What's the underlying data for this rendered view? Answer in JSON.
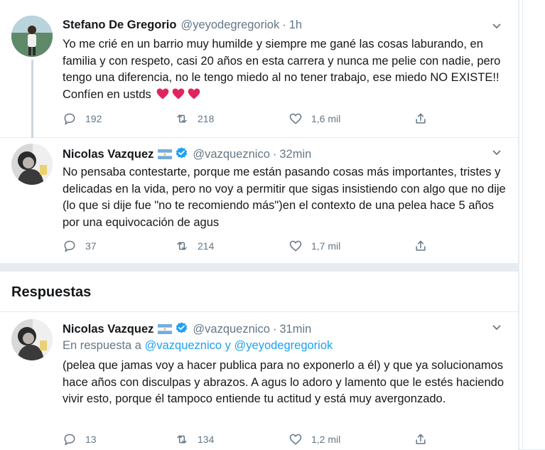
{
  "tweets": [
    {
      "name": "Stefano De Gregorio",
      "handle": "@yeyodegregoriok",
      "sep": "·",
      "time": "1h",
      "text": "Yo me crié en un barrio muy humilde y siempre me gané las cosas laburando, en familia y con respeto, casi 20 años en esta carrera y nunca me pelie con nadie, pero tengo una diferencia, no le tengo miedo al no tener trabajo, ese miedo NO EXISTE!! Confíen en ustds",
      "replies": "192",
      "retweets": "218",
      "likes": "1,6 mil"
    },
    {
      "name": "Nicolas Vazquez",
      "handle": "@vazqueznico",
      "sep": "·",
      "time": "32min",
      "text": "No pensaba contestarte, porque me están pasando cosas más importantes, tristes y delicadas en la vida, pero no voy a permitir que sigas insistiendo con algo que no dije (lo que si dije fue \"no te recomiendo más\")en el contexto de una pelea hace 5 años por una equivocación de agus",
      "replies": "37",
      "retweets": "214",
      "likes": "1,7 mil"
    },
    {
      "name": "Nicolas Vazquez",
      "handle": "@vazqueznico",
      "sep": "·",
      "time": "31min",
      "reply_prefix": "En respuesta a",
      "reply_to_1": "@vazqueznico",
      "reply_and": "y",
      "reply_to_2": "@yeyodegregoriok",
      "text": "(pelea que jamas voy a hacer publica para no exponerlo a él) y que ya solucionamos hace años con disculpas y abrazos. A agus lo adoro y lamento que le estés haciendo vivir esto, porque él tampoco entiende tu actitud y está muy avergonzado.",
      "replies": "13",
      "retweets": "134",
      "likes": "1,2 mil"
    }
  ],
  "section": {
    "title": "Respuestas"
  },
  "icons": {
    "reply": "reply-icon",
    "retweet": "retweet-icon",
    "like": "like-icon",
    "share": "share-icon",
    "more": "chevron-down-icon",
    "verified": "verified-badge-icon",
    "flag": "argentina-flag-icon",
    "heart_emoji": "red-heart-emoji"
  },
  "colors": {
    "text": "#14171a",
    "muted": "#657786",
    "link": "#1da1f2",
    "divider": "#e6ecf0",
    "heart": "#e0245e"
  }
}
